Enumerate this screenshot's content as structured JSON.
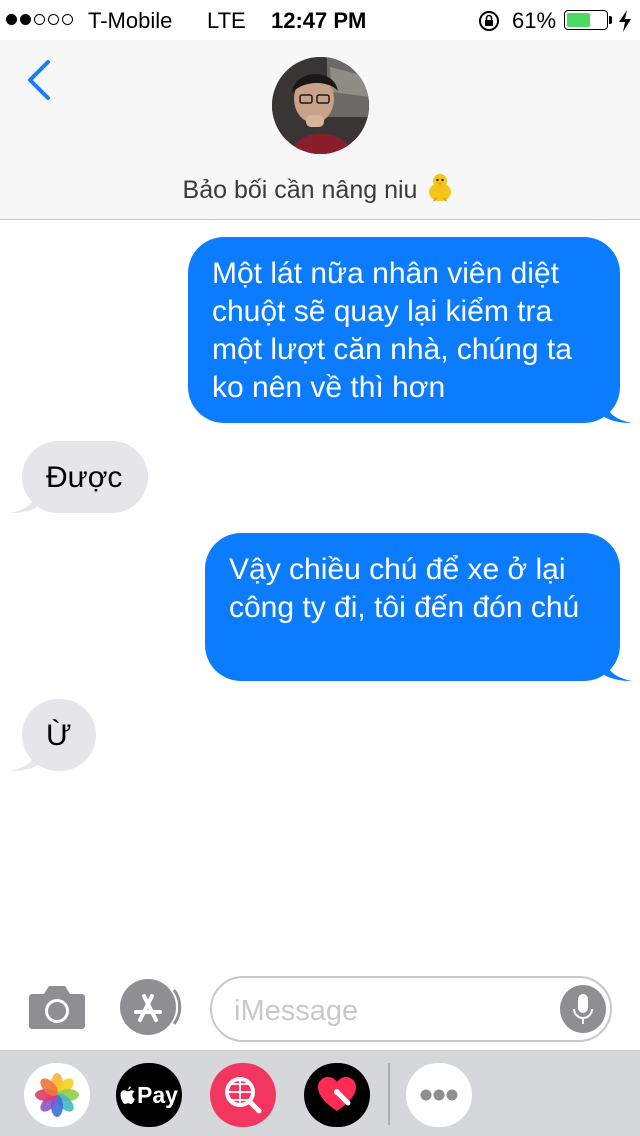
{
  "status_bar": {
    "carrier": "T-Mobile",
    "network": "LTE",
    "time": "12:47 PM",
    "battery_percent": "61%",
    "battery_level": 0.61,
    "signal_bars_filled": 2,
    "signal_bars_total": 5
  },
  "header": {
    "contact_name": "Bảo bối cần nâng niu",
    "name_emoji_icon": "baby-chick-icon"
  },
  "messages": [
    {
      "direction": "sent",
      "text": "Một lát nữa nhân viên diệt chuột sẽ quay lại kiểm tra một lượt căn nhà, chúng ta ko nên về thì hơn"
    },
    {
      "direction": "received",
      "text": "Được"
    },
    {
      "direction": "sent",
      "text": "Vậy chiều chú để xe ở lại công ty đi, tôi đến đón chú"
    },
    {
      "direction": "received",
      "text": "Ừ"
    }
  ],
  "input_bar": {
    "placeholder": "iMessage"
  },
  "app_drawer": {
    "apple_pay_label": "Pay",
    "apps": [
      "photos-icon",
      "apple-pay-icon",
      "web-search-icon",
      "digital-touch-icon",
      "more-apps-icon"
    ]
  },
  "colors": {
    "sent_bubble": "#0b7cfd",
    "received_bubble": "#e5e5ea",
    "accent": "#157efb",
    "battery": "#4cd964"
  }
}
